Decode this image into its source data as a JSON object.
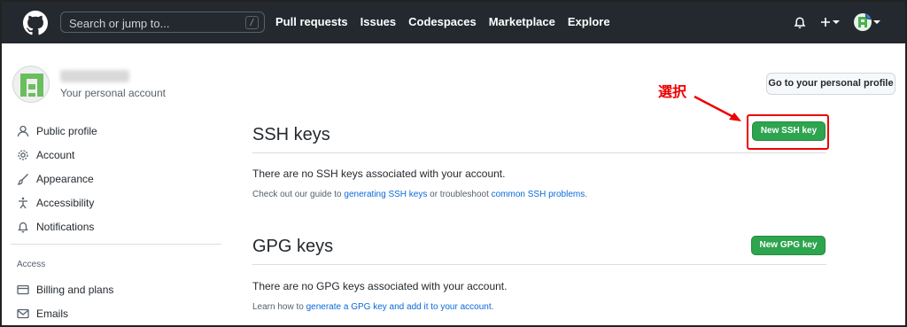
{
  "header": {
    "search_placeholder": "Search or jump to...",
    "search_shortcut": "/",
    "nav": [
      "Pull requests",
      "Issues",
      "Codespaces",
      "Marketplace",
      "Explore"
    ]
  },
  "account": {
    "subtitle": "Your personal account",
    "profile_button": "Go to your personal profile"
  },
  "sidebar": {
    "items": [
      {
        "label": "Public profile",
        "icon": "person-icon"
      },
      {
        "label": "Account",
        "icon": "gear-icon"
      },
      {
        "label": "Appearance",
        "icon": "paintbrush-icon"
      },
      {
        "label": "Accessibility",
        "icon": "accessibility-icon"
      },
      {
        "label": "Notifications",
        "icon": "bell-icon"
      }
    ],
    "access_heading": "Access",
    "access_items": [
      {
        "label": "Billing and plans",
        "icon": "credit-card-icon"
      },
      {
        "label": "Emails",
        "icon": "mail-icon"
      }
    ]
  },
  "ssh": {
    "title": "SSH keys",
    "button": "New SSH key",
    "empty": "There are no SSH keys associated with your account.",
    "help_prefix": "Check out our guide to ",
    "help_link1": "generating SSH keys",
    "help_middle": " or troubleshoot ",
    "help_link2": "common SSH problems",
    "help_suffix": "."
  },
  "gpg": {
    "title": "GPG keys",
    "button": "New GPG key",
    "empty": "There are no GPG keys associated with your account.",
    "help_prefix": "Learn how to ",
    "help_link": "generate a GPG key and add it to your account",
    "help_suffix": "."
  },
  "annotation": {
    "label": "選択",
    "color": "#ee0000"
  },
  "colors": {
    "header_bg": "#24292f",
    "primary_green": "#2da44e",
    "link": "#0969da"
  }
}
